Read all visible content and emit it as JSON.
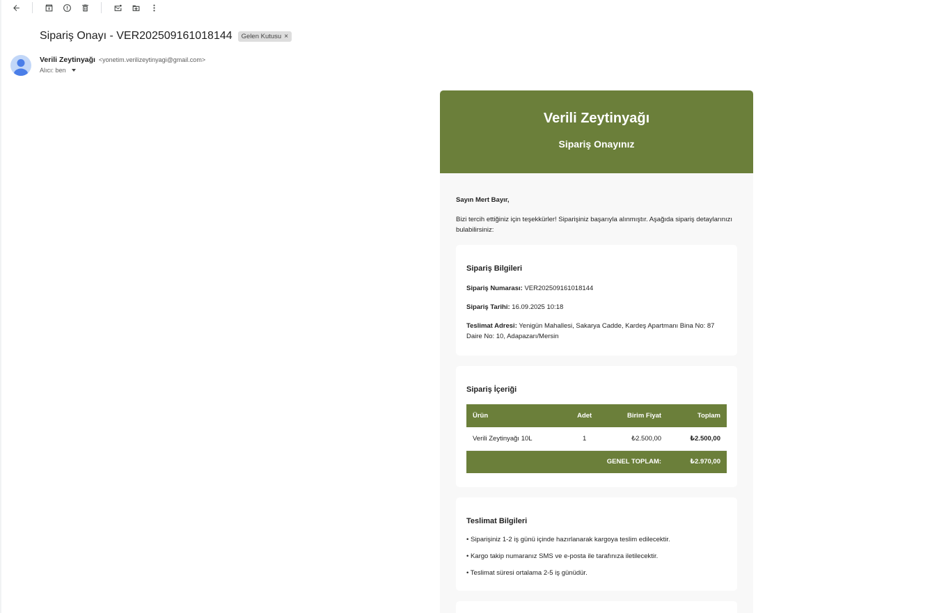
{
  "toolbar": {
    "icons": [
      "back-arrow-icon",
      "archive-icon",
      "report-spam-icon",
      "delete-icon",
      "mark-unread-icon",
      "move-to-icon",
      "more-vert-icon"
    ]
  },
  "email": {
    "subject": "Sipariş Onayı - VER202509161018144",
    "label_chip": "Gelen Kutusu",
    "sender_name": "Verili Zeytinyağı",
    "sender_email": "<yonetim.verilizeytinyagi@gmail.com>",
    "to_line": "Alıcı: ben"
  },
  "body": {
    "brand": "Verili Zeytinyağı",
    "brand_subtitle": "Sipariş Onayınız",
    "greeting": "Sayın Mert Bayır,",
    "intro": "Bizi tercih ettiğiniz için teşekkürler! Siparişiniz başarıyla alınmıştır. Aşağıda sipariş detaylarınızı bulabilirsiniz:",
    "order_info": {
      "title": "Sipariş Bilgileri",
      "number_label": "Sipariş Numarası:",
      "number_value": "VER202509161018144",
      "date_label": "Sipariş Tarihi:",
      "date_value": "16.09.2025 10:18",
      "address_label": "Teslimat Adresi:",
      "address_value": "Yenigün Mahallesi, Sakarya Cadde, Kardeş Apartmanı Bina No: 87 Daire No: 10, Adapazarı/Mersin"
    },
    "order_content": {
      "title": "Sipariş İçeriği",
      "headers": {
        "product": "Ürün",
        "qty": "Adet",
        "unit_price": "Birim Fiyat",
        "total": "Toplam"
      },
      "rows": [
        {
          "product": "Verili Zeytinyağı 10L",
          "qty": "1",
          "unit_price": "₺2.500,00",
          "total": "₺2.500,00"
        }
      ],
      "grand_total_label": "GENEL TOPLAM:",
      "grand_total_value": "₺2.970,00"
    },
    "delivery": {
      "title": "Teslimat Bilgileri",
      "bullets": [
        "• Siparişiniz 1-2 iş günü içinde hazırlanarak kargoya teslim edilecektir.",
        "• Kargo takip numaranız SMS ve e-posta ile tarafınıza iletilecektir.",
        "• Teslimat süresi ortalama 2-5 iş günüdür."
      ]
    }
  },
  "colors": {
    "brand_green": "#6b7f3a",
    "body_bg": "#f8f8f8",
    "avatar_bg": "#c2d7f8"
  }
}
